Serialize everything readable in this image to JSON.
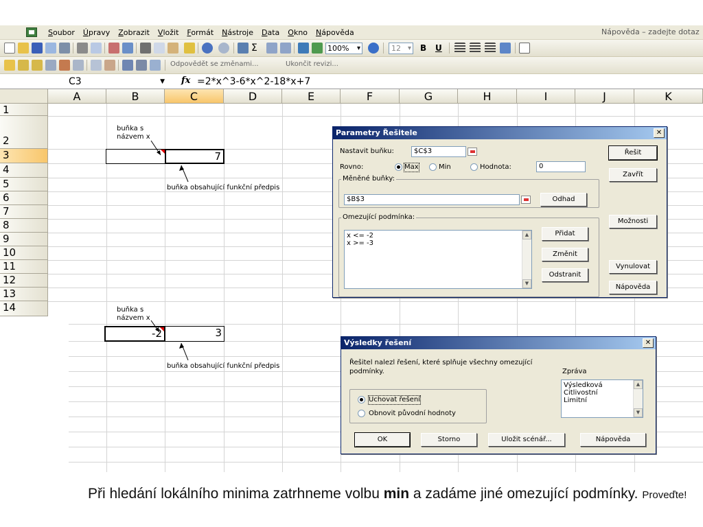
{
  "menubar": {
    "items": [
      "Soubor",
      "Úpravy",
      "Zobrazit",
      "Vložit",
      "Formát",
      "Nástroje",
      "Data",
      "Okno",
      "Nápověda"
    ],
    "help_placeholder": "Nápověda – zadejte dotaz"
  },
  "toolbar": {
    "zoom": "100%",
    "font_size": "12",
    "bold": "B",
    "underline": "U",
    "reply_changes": "Odpovědět se změnami...",
    "end_review": "Ukončit revizi..."
  },
  "formula_bar": {
    "name_box": "C3",
    "fx": "fx",
    "formula": "=2*x^3-6*x^2-18*x+7"
  },
  "grid": {
    "columns": [
      "A",
      "B",
      "C",
      "D",
      "E",
      "F",
      "G",
      "H",
      "I",
      "J",
      "K"
    ],
    "rows": [
      "1",
      "2",
      "3",
      "4",
      "5",
      "6",
      "7",
      "8",
      "9",
      "10",
      "11",
      "12",
      "13",
      "14"
    ]
  },
  "top_example": {
    "x_cell_value": "",
    "fx_cell_value": "7",
    "label_x_line1": "buňka s",
    "label_x_line2": "názvem x",
    "label_fx": "buňka obsahující funkční předpis"
  },
  "bottom_example": {
    "x_cell_value": "-2",
    "fx_cell_value": "3",
    "label_x_line1": "buňka s",
    "label_x_line2": "názvem x",
    "label_fx": "buňka obsahující funkční předpis"
  },
  "solver_dialog": {
    "title": "Parametry Řešitele",
    "set_cell_label": "Nastavit buňku:",
    "set_cell_value": "$C$3",
    "equal_to_label": "Rovno:",
    "opt_max": "Max",
    "opt_min": "Min",
    "opt_value": "Hodnota:",
    "value_input": "0",
    "changing_cells_label": "Měněné buňky:",
    "changing_cells_value": "$B$3",
    "guess_button": "Odhad",
    "constraints_label": "Omezující podmínka:",
    "constraints": [
      "x <= -2",
      "x >= -3"
    ],
    "add_button": "Přidat",
    "change_button": "Změnit",
    "delete_button": "Odstranit",
    "solve_button": "Řešit",
    "close_button": "Zavřít",
    "options_button": "Možnosti",
    "reset_button": "Vynulovat",
    "help_button": "Nápověda"
  },
  "results_dialog": {
    "title": "Výsledky řešení",
    "message_line1": "Řešitel nalezl řešení, které splňuje všechny omezující",
    "message_line2": "podmínky.",
    "report_label": "Zpráva",
    "reports": [
      "Výsledková",
      "Citlivostní",
      "Limitní"
    ],
    "keep_solution": "Uchovat řešení",
    "restore_values": "Obnovit původní hodnoty",
    "ok_button": "OK",
    "cancel_button": "Storno",
    "save_scenario_button": "Uložit scénář...",
    "help_button": "Nápověda"
  },
  "caption": {
    "part1": "Při hledání lokálního minima zatrhneme volbu ",
    "bold": "min",
    "part2": " a zadáme jiné omezující podmínky. ",
    "small": "Proveďte!"
  }
}
